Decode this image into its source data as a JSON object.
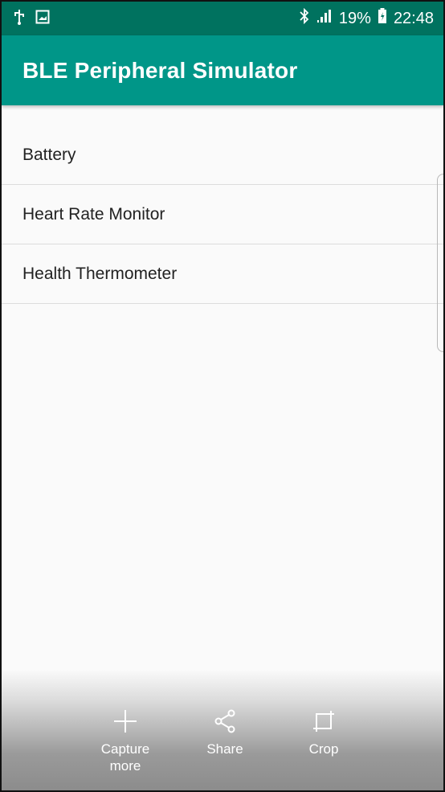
{
  "status_bar": {
    "icons_left": [
      "usb-icon",
      "image-icon"
    ],
    "icons_right": [
      "bluetooth-icon",
      "signal-icon",
      "battery-charging-icon"
    ],
    "battery_percent": "19%",
    "time": "22:48",
    "color": "#00725f"
  },
  "app_bar": {
    "title": "BLE Peripheral Simulator",
    "color": "#009688"
  },
  "services": [
    {
      "label": "Battery"
    },
    {
      "label": "Heart Rate Monitor"
    },
    {
      "label": "Health Thermometer"
    }
  ],
  "screenshot_toolbar": {
    "actions": [
      {
        "label": "Capture more",
        "icon": "plus-icon"
      },
      {
        "label": "Share",
        "icon": "share-icon"
      },
      {
        "label": "Crop",
        "icon": "crop-icon"
      }
    ]
  }
}
